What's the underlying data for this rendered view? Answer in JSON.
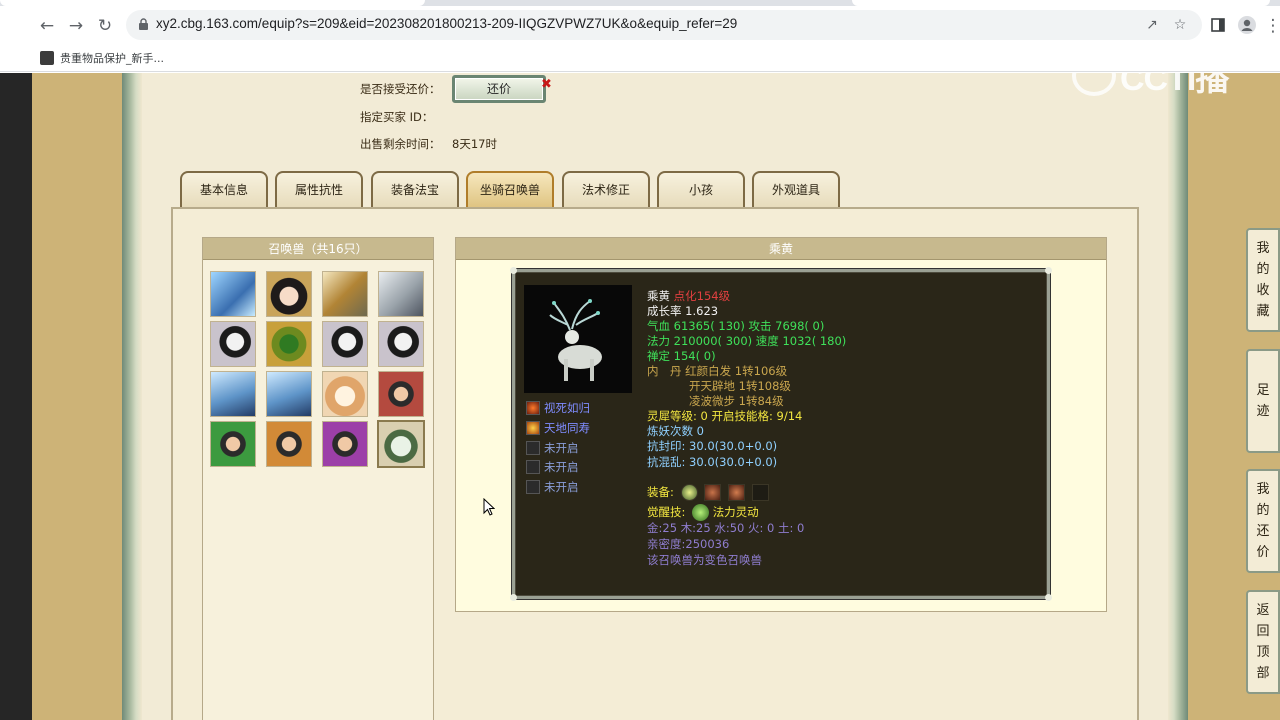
{
  "browser": {
    "url": "xy2.cbg.163.com/equip?s=209&eid=202308201800213-209-IIQGZVPWZ7UK&o&equip_refer=29",
    "bookmark_label": "贵重物品保护_新手..."
  },
  "watermark": "CCTI播",
  "trade": {
    "accept_counter_label": "是否接受还价：",
    "counter_offer_button": "还价",
    "designated_buyer_label": "指定买家 ID：",
    "remaining_time_label": "出售剩余时间：",
    "remaining_time_value": "8天17时"
  },
  "tabs": [
    "基本信息",
    "属性抗性",
    "装备法宝",
    "坐骑召唤兽",
    "法术修正",
    "小孩",
    "外观道具"
  ],
  "active_tab": "坐骑召唤兽",
  "pet_list": {
    "title": "召唤兽（共16只）",
    "count": 16,
    "selected_index": 15
  },
  "pet_detail": {
    "header": "乘黄",
    "name": "乘黄",
    "dianhua": "点化154级",
    "growth": "成长率 1.623",
    "hp_label": "气血",
    "hp": "61365( 130)",
    "atk_label": "攻击",
    "atk": "7698( 0)",
    "mp_label": "法力",
    "mp": "210000( 300)",
    "spd_label": "速度",
    "spd": "1032( 180)",
    "chanding_label": "禅定",
    "chanding": "154( 0)",
    "neidan_label": "内　丹",
    "neidan": [
      "红颜白发 1转106级",
      "开天辟地 1转108级",
      "凌波微步 1转84级"
    ],
    "lingxi_line": "灵犀等级:  0 开启技能格:  9/14",
    "lianyao": "炼妖次数 0",
    "kangfengyin": "抗封印: 30.0(30.0+0.0)",
    "kanghunluan": "抗混乱: 30.0(30.0+0.0)",
    "equip_label": "装备:",
    "awaken_label": "觉醒技:",
    "awaken_skill": "法力灵动",
    "wuxing": "金:25 木:25 水:50 火: 0 土: 0",
    "intimacy": "亲密度:250036",
    "variant_note": "该召唤兽为变色召唤兽",
    "skills": [
      "视死如归",
      "天地同寿",
      "未开启",
      "未开启",
      "未开启"
    ]
  },
  "float_buttons": [
    {
      "chars": [
        "我",
        "的",
        "收",
        "藏"
      ]
    },
    {
      "chars": [
        "足",
        "迹"
      ]
    },
    {
      "chars": [
        "我",
        "的",
        "还",
        "价"
      ]
    },
    {
      "chars": [
        "返",
        "回",
        "顶",
        "部"
      ]
    }
  ]
}
